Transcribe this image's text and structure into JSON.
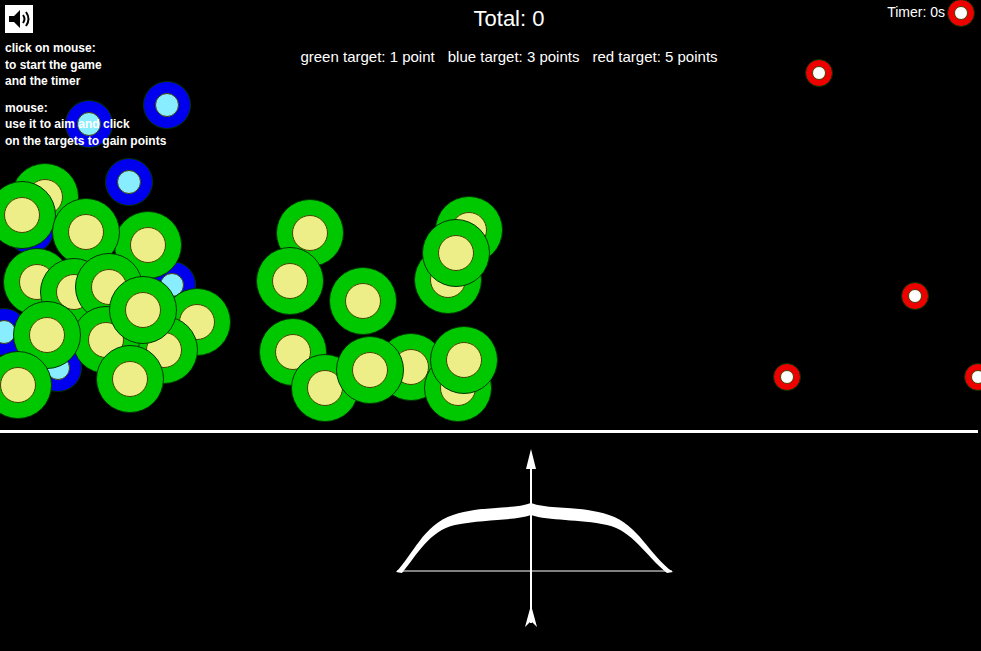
{
  "sound": {
    "on": true
  },
  "instructions": [
    {
      "heading": "click on mouse:",
      "lines": [
        "to start the game",
        "and the timer"
      ]
    },
    {
      "heading": "mouse:",
      "lines": [
        "use it to aim and click",
        "on the targets to gain points"
      ]
    }
  ],
  "total": "Total: 0",
  "timer": "Timer: 0s",
  "legend": [
    "green target: 1 point",
    "blue target: 3 points",
    "red target: 5 points"
  ],
  "targets": [
    {
      "kind": "blue",
      "color": "#0000ee"
    },
    {
      "kind": "blue",
      "color": "#0000ee"
    },
    {
      "kind": "blue",
      "color": "#0000ee"
    },
    {
      "kind": "blue",
      "color": "#0000ee"
    },
    {
      "kind": "blue",
      "color": "#0000ee"
    },
    {
      "kind": "blue",
      "color": "#0000ee"
    },
    {
      "kind": "blue",
      "color": "#0000ee"
    },
    {
      "kind": "green",
      "color": "#00c800"
    },
    {
      "kind": "green",
      "color": "#00c800"
    },
    {
      "kind": "green",
      "color": "#00c800"
    },
    {
      "kind": "green",
      "color": "#00c800"
    },
    {
      "kind": "green",
      "color": "#00c800"
    },
    {
      "kind": "green",
      "color": "#00c800"
    },
    {
      "kind": "green",
      "color": "#00c800"
    },
    {
      "kind": "green",
      "color": "#00c800"
    },
    {
      "kind": "green",
      "color": "#00c800"
    },
    {
      "kind": "green",
      "color": "#00c800"
    },
    {
      "kind": "green",
      "color": "#00c800"
    },
    {
      "kind": "green",
      "color": "#00c800"
    },
    {
      "kind": "green",
      "color": "#00c800"
    },
    {
      "kind": "green",
      "color": "#00c800"
    },
    {
      "kind": "green",
      "color": "#00c800"
    },
    {
      "kind": "green",
      "color": "#00c800"
    },
    {
      "kind": "green",
      "color": "#00c800"
    },
    {
      "kind": "green",
      "color": "#00c800"
    },
    {
      "kind": "green",
      "color": "#00c800"
    },
    {
      "kind": "green",
      "color": "#00c800"
    },
    {
      "kind": "green",
      "color": "#00c800"
    },
    {
      "kind": "green",
      "color": "#00c800"
    },
    {
      "kind": "green",
      "color": "#00c800"
    },
    {
      "kind": "green",
      "color": "#00c800"
    },
    {
      "kind": "green",
      "color": "#00c800"
    },
    {
      "kind": "green",
      "color": "#00c800"
    },
    {
      "kind": "red",
      "color": "#ee0000"
    },
    {
      "kind": "red",
      "color": "#ee0000"
    },
    {
      "kind": "red",
      "color": "#ee0000"
    },
    {
      "kind": "red",
      "color": "#ee0000"
    },
    {
      "kind": "red",
      "color": "#ee0000"
    }
  ]
}
